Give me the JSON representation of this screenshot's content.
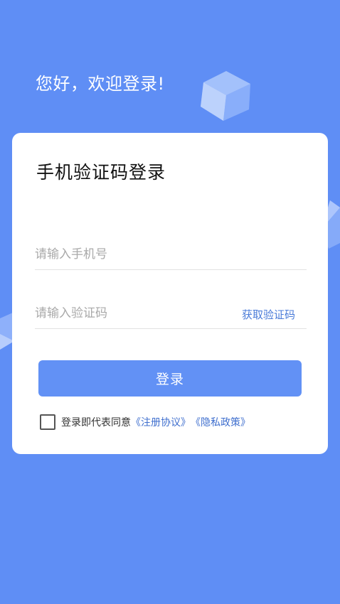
{
  "greeting": "您好，欢迎登录!",
  "card": {
    "title": "手机验证码登录",
    "phone_placeholder": "请输入手机号",
    "code_placeholder": "请输入验证码",
    "get_code_label": "获取验证码",
    "login_label": "登录"
  },
  "agreement": {
    "prefix": "登录即代表同意",
    "register_link": "《注册协议》",
    "privacy_link": "《隐私政策》"
  },
  "colors": {
    "background": "#5f8ef5",
    "accent": "#6291f5",
    "link": "#3f6fce"
  }
}
